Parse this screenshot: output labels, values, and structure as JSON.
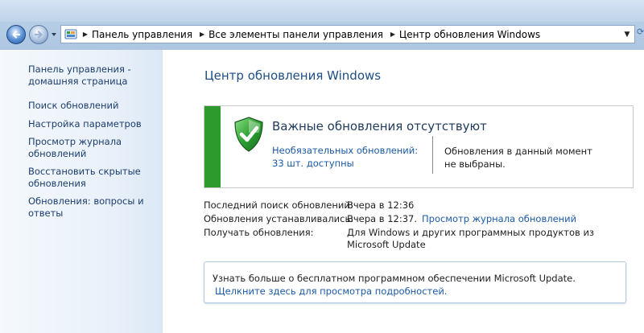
{
  "address_bar": {
    "crumbs": [
      "Панель управления",
      "Все элементы панели управления",
      "Центр обновления Windows"
    ]
  },
  "left_pane": {
    "home_link": "Панель управления - домашняя страница",
    "links": [
      "Поиск обновлений",
      "Настройка параметров",
      "Просмотр журнала обновлений",
      "Восстановить скрытые обновления",
      "Обновления: вопросы и ответы"
    ]
  },
  "main": {
    "title": "Центр обновления Windows",
    "status": {
      "heading": "Важные обновления отсутствуют",
      "optional_link": "Необязательных обновлений: 33 шт. доступны",
      "selection_text": "Обновления в данный момент не выбраны.",
      "accent_color": "#2c9a2c"
    },
    "info": {
      "last_search_label": "Последний поиск обновлений:",
      "last_search_value": "Вчера в 12:36",
      "installed_label": "Обновления устанавливались:",
      "installed_value": "Вчера в 12:37.",
      "history_link": "Просмотр журнала обновлений",
      "receive_label": "Получать обновления:",
      "receive_value": "Для Windows и других программных продуктов из Microsoft Update"
    },
    "microsoft_update": {
      "text": "Узнать больше о бесплатном программном обеспечении Microsoft Update.",
      "link": "Щелкните здесь для просмотра подробностей."
    }
  },
  "icons": {
    "back": "back-arrow-icon",
    "forward": "forward-arrow-icon",
    "control_panel": "control-panel-icon",
    "shield": "shield-check-icon"
  }
}
